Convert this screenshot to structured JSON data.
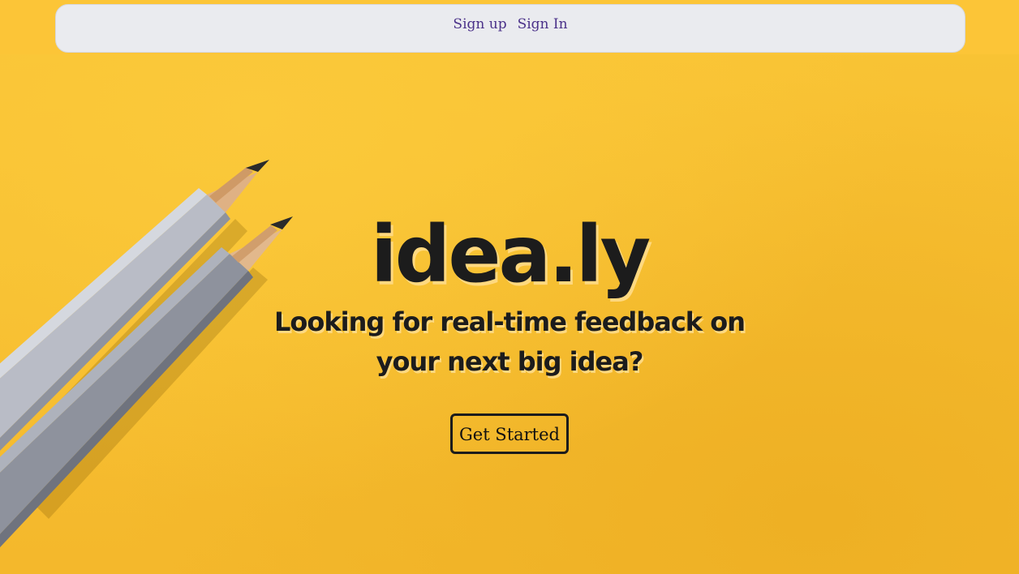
{
  "nav": {
    "signup_label": "Sign up",
    "signin_label": "Sign In"
  },
  "hero": {
    "logo": "idea.ly",
    "tagline": "Looking for real-time feedback on your next big idea?",
    "cta_label": "Get Started"
  },
  "colors": {
    "background": "#f6bd2f",
    "navbar": "#eaebef",
    "nav_link": "#4a3189",
    "text": "#1c1c1c"
  }
}
